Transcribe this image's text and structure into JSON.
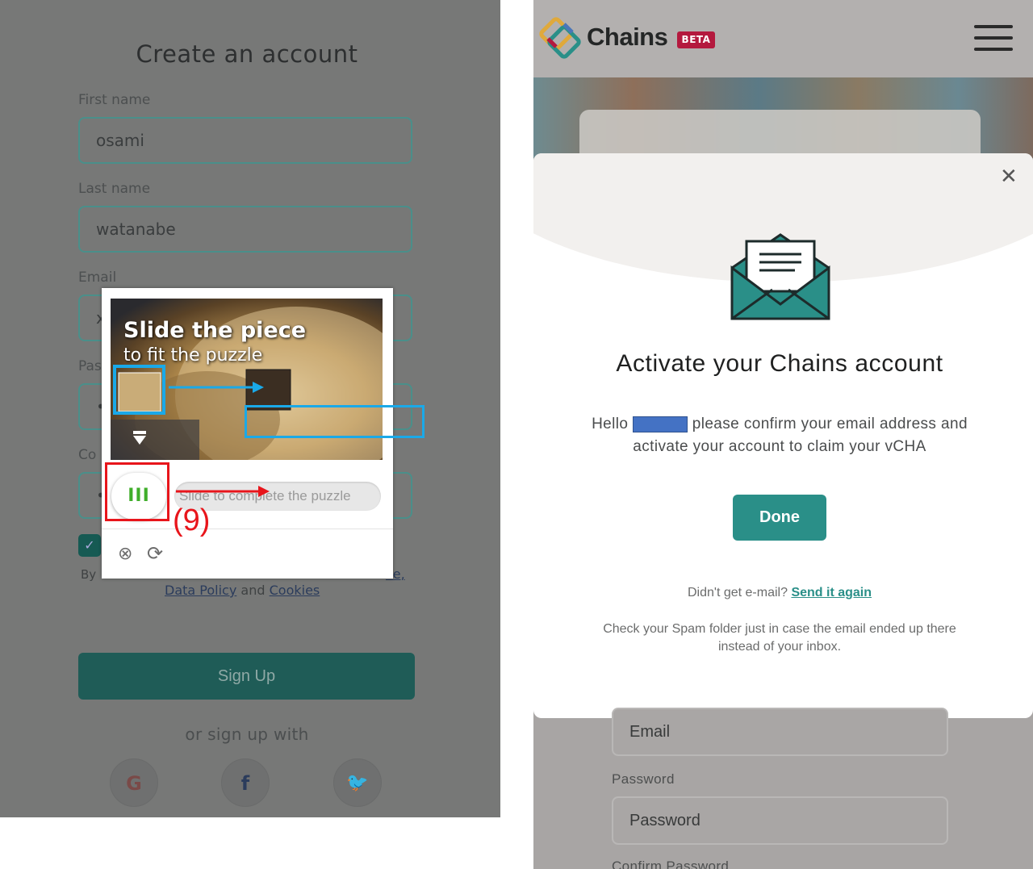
{
  "left_screen": {
    "title": "Create an account",
    "fields": [
      {
        "label": "First name",
        "value": "osami"
      },
      {
        "label": "Last name",
        "value": "watanabe"
      },
      {
        "label": "Email",
        "value": "x"
      },
      {
        "label": "Pas",
        "value": "•"
      },
      {
        "label": "Co",
        "value": "•"
      }
    ],
    "terms_prefix": "By",
    "terms_link_fragment": "ce,",
    "data_policy_link": "Data Policy",
    "and_text": "and",
    "cookies_link": "Cookies",
    "signup_button": "Sign Up",
    "or_sign_up_with": "or sign up with",
    "social": [
      {
        "name": "google",
        "glyph": "G"
      },
      {
        "name": "facebook",
        "glyph": "f"
      },
      {
        "name": "twitter",
        "glyph": "🐦"
      }
    ]
  },
  "captcha": {
    "heading": "Slide the piece",
    "subheading": "to fit the puzzle",
    "slider_text": "Slide to complete the puzzle",
    "knob_glyph": "III",
    "step_label": "(9)"
  },
  "right_screen": {
    "brand": "Chains",
    "beta_badge": "BETA",
    "modal": {
      "close_glyph": "✕",
      "title": "Activate your Chains account",
      "body_hello": "Hello",
      "body_please": "please",
      "body_highlight": "confirm your email",
      "body_rest": "address and activate your account to claim your vCHA",
      "done_button": "Done",
      "resend_prompt": "Didn't get e-mail?",
      "resend_link": "Send it again",
      "spam_note": "Check your Spam folder just in case the email ended up there instead of your inbox."
    },
    "behind_form": {
      "email_placeholder": "Email",
      "password_label": "Password",
      "password_placeholder": "Password",
      "confirm_password_label": "Confirm Password"
    }
  },
  "colors": {
    "teal": "#2a8f88",
    "annotation_red": "#e8151b",
    "annotation_blue": "#1aa9e8",
    "beta_red": "#b4193e"
  }
}
